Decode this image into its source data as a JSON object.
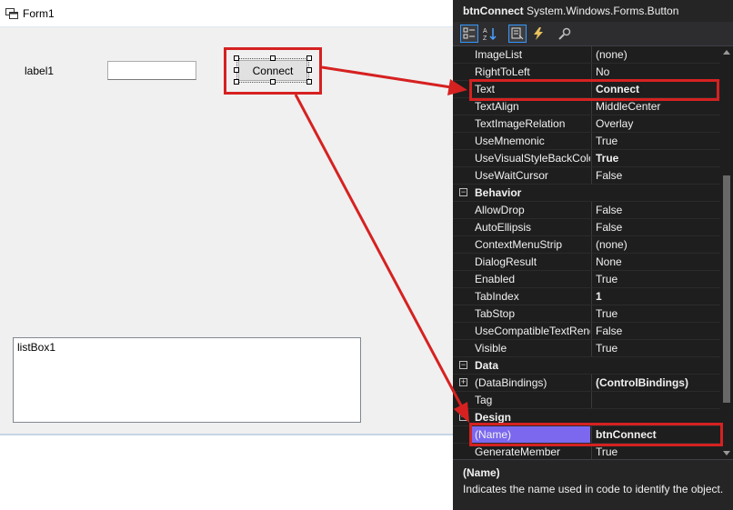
{
  "form": {
    "title": "Form1",
    "label1": "label1",
    "textbox_value": "",
    "button_text": "Connect",
    "listbox_text": "listBox1"
  },
  "properties": {
    "object_name": "btnConnect",
    "object_type": "System.Windows.Forms.Button",
    "toolbar": [
      "categorized-icon",
      "alphabetical-icon",
      "properties-icon",
      "events-icon",
      "property-pages-icon"
    ],
    "rows": [
      {
        "name": "ImageList",
        "value": "(none)",
        "bold": false
      },
      {
        "name": "RightToLeft",
        "value": "No",
        "bold": false
      },
      {
        "name": "Text",
        "value": "Connect",
        "bold": true
      },
      {
        "name": "TextAlign",
        "value": "MiddleCenter",
        "bold": false
      },
      {
        "name": "TextImageRelation",
        "value": "Overlay",
        "bold": false
      },
      {
        "name": "UseMnemonic",
        "value": "True",
        "bold": false
      },
      {
        "name": "UseVisualStyleBackColor",
        "value": "True",
        "bold": true
      },
      {
        "name": "UseWaitCursor",
        "value": "False",
        "bold": false
      },
      {
        "category": "Behavior"
      },
      {
        "name": "AllowDrop",
        "value": "False",
        "bold": false
      },
      {
        "name": "AutoEllipsis",
        "value": "False",
        "bold": false
      },
      {
        "name": "ContextMenuStrip",
        "value": "(none)",
        "bold": false
      },
      {
        "name": "DialogResult",
        "value": "None",
        "bold": false
      },
      {
        "name": "Enabled",
        "value": "True",
        "bold": false
      },
      {
        "name": "TabIndex",
        "value": "1",
        "bold": true
      },
      {
        "name": "TabStop",
        "value": "True",
        "bold": false
      },
      {
        "name": "UseCompatibleTextRendering",
        "value": "False",
        "bold": false
      },
      {
        "name": "Visible",
        "value": "True",
        "bold": false
      },
      {
        "category": "Data"
      },
      {
        "name": "(DataBindings)",
        "value": "(ControlBindings)",
        "bold": true,
        "expandable": true
      },
      {
        "name": "Tag",
        "value": "",
        "bold": false
      },
      {
        "category": "Design"
      },
      {
        "name": "(Name)",
        "value": "btnConnect",
        "bold": true,
        "selected": true
      },
      {
        "name": "GenerateMember",
        "value": "True",
        "bold": false
      }
    ],
    "description_title": "(Name)",
    "description_text": "Indicates the name used in code to identify the object."
  },
  "colors": {
    "highlight": "#d62121",
    "selection": "#7b68ee",
    "panel_bg": "#1e1e1e"
  }
}
